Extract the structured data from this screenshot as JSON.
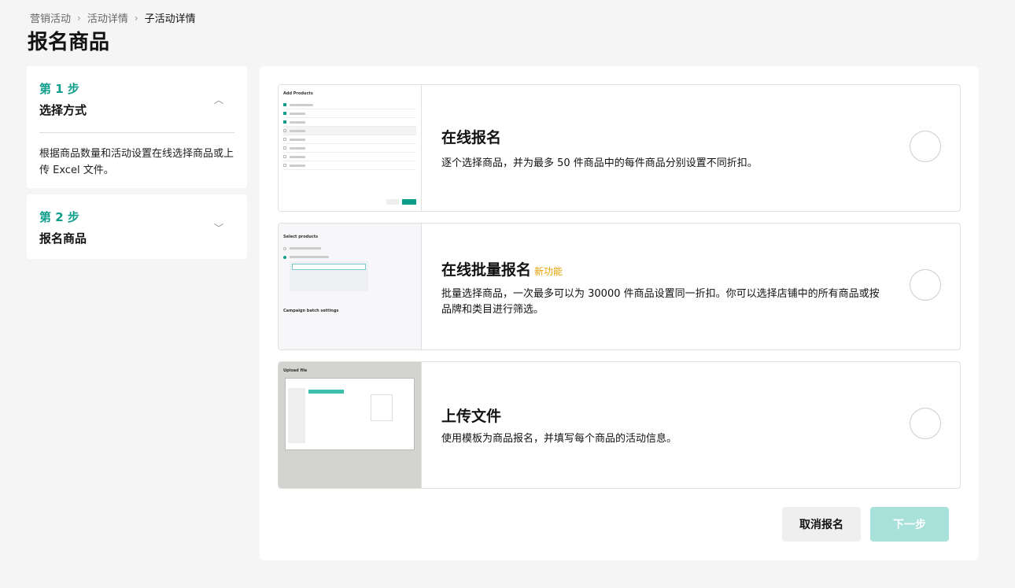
{
  "breadcrumb": [
    "营销活动",
    "活动详情",
    "子活动详情"
  ],
  "page_title": "报名商品",
  "steps": [
    {
      "num": "第 1 步",
      "name": "选择方式",
      "desc": "根据商品数量和活动设置在线选择商品或上传 Excel 文件。",
      "expanded": true
    },
    {
      "num": "第 2 步",
      "name": "报名商品",
      "expanded": false
    }
  ],
  "options": [
    {
      "title": "在线报名",
      "desc": "逐个选择商品，并为最多 50 件商品中的每件商品分别设置不同折扣。",
      "thumb_title": "Add Products"
    },
    {
      "title": "在线批量报名",
      "badge": "新功能",
      "desc": "批量选择商品，一次最多可以为 30000 件商品设置同一折扣。你可以选择店铺中的所有商品或按品牌和类目进行筛选。",
      "thumb_title": "Select products",
      "thumb_sub": "Campaign batch settings"
    },
    {
      "title": "上传文件",
      "desc": "使用模板为商品报名，并填写每个商品的活动信息。",
      "thumb_title": "Upload file"
    }
  ],
  "buttons": {
    "cancel": "取消报名",
    "next": "下一步"
  },
  "colors": {
    "accent": "#0f9d8c",
    "next_disabled": "#a8e0da",
    "badge": "#e6a100"
  }
}
